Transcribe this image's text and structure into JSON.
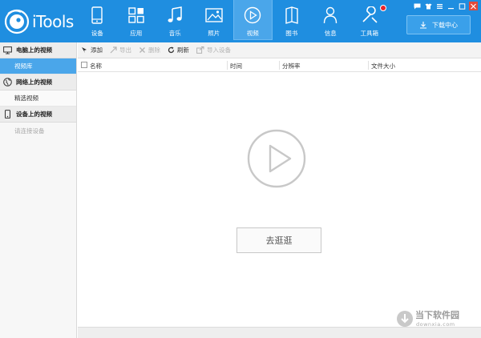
{
  "app": {
    "logo_text": "iTools"
  },
  "nav": {
    "items": [
      {
        "label": "设备",
        "icon": "phone-icon"
      },
      {
        "label": "应用",
        "icon": "apps-icon"
      },
      {
        "label": "音乐",
        "icon": "music-icon"
      },
      {
        "label": "照片",
        "icon": "photo-icon"
      },
      {
        "label": "视频",
        "icon": "video-icon",
        "active": true
      },
      {
        "label": "图书",
        "icon": "book-icon"
      },
      {
        "label": "信息",
        "icon": "user-icon"
      },
      {
        "label": "工具箱",
        "icon": "wrench-icon"
      }
    ],
    "download_center": "下载中心"
  },
  "sidebar": {
    "sections": [
      {
        "title": "电脑上的视频",
        "icon": "monitor-icon",
        "items": [
          {
            "label": "视频库",
            "active": true
          }
        ]
      },
      {
        "title": "网络上的视频",
        "icon": "globe-icon",
        "items": [
          {
            "label": "精选视频"
          }
        ]
      },
      {
        "title": "设备上的视频",
        "icon": "device-icon",
        "items": [
          {
            "label": "请连接设备",
            "disabled": true
          }
        ]
      }
    ]
  },
  "toolbar": {
    "add": "添加",
    "export": "导出",
    "delete": "删除",
    "refresh": "刷新",
    "import_device": "导入设备"
  },
  "columns": {
    "name": "名称",
    "time": "时间",
    "resolution": "分辨率",
    "size": "文件大小"
  },
  "empty_state": {
    "button": "去逛逛"
  },
  "watermark": {
    "text": "当下软件园",
    "url": "downxia.com"
  },
  "colors": {
    "accent": "#1f8ee0",
    "active": "#4aa6ea",
    "notification": "#e8242b"
  }
}
